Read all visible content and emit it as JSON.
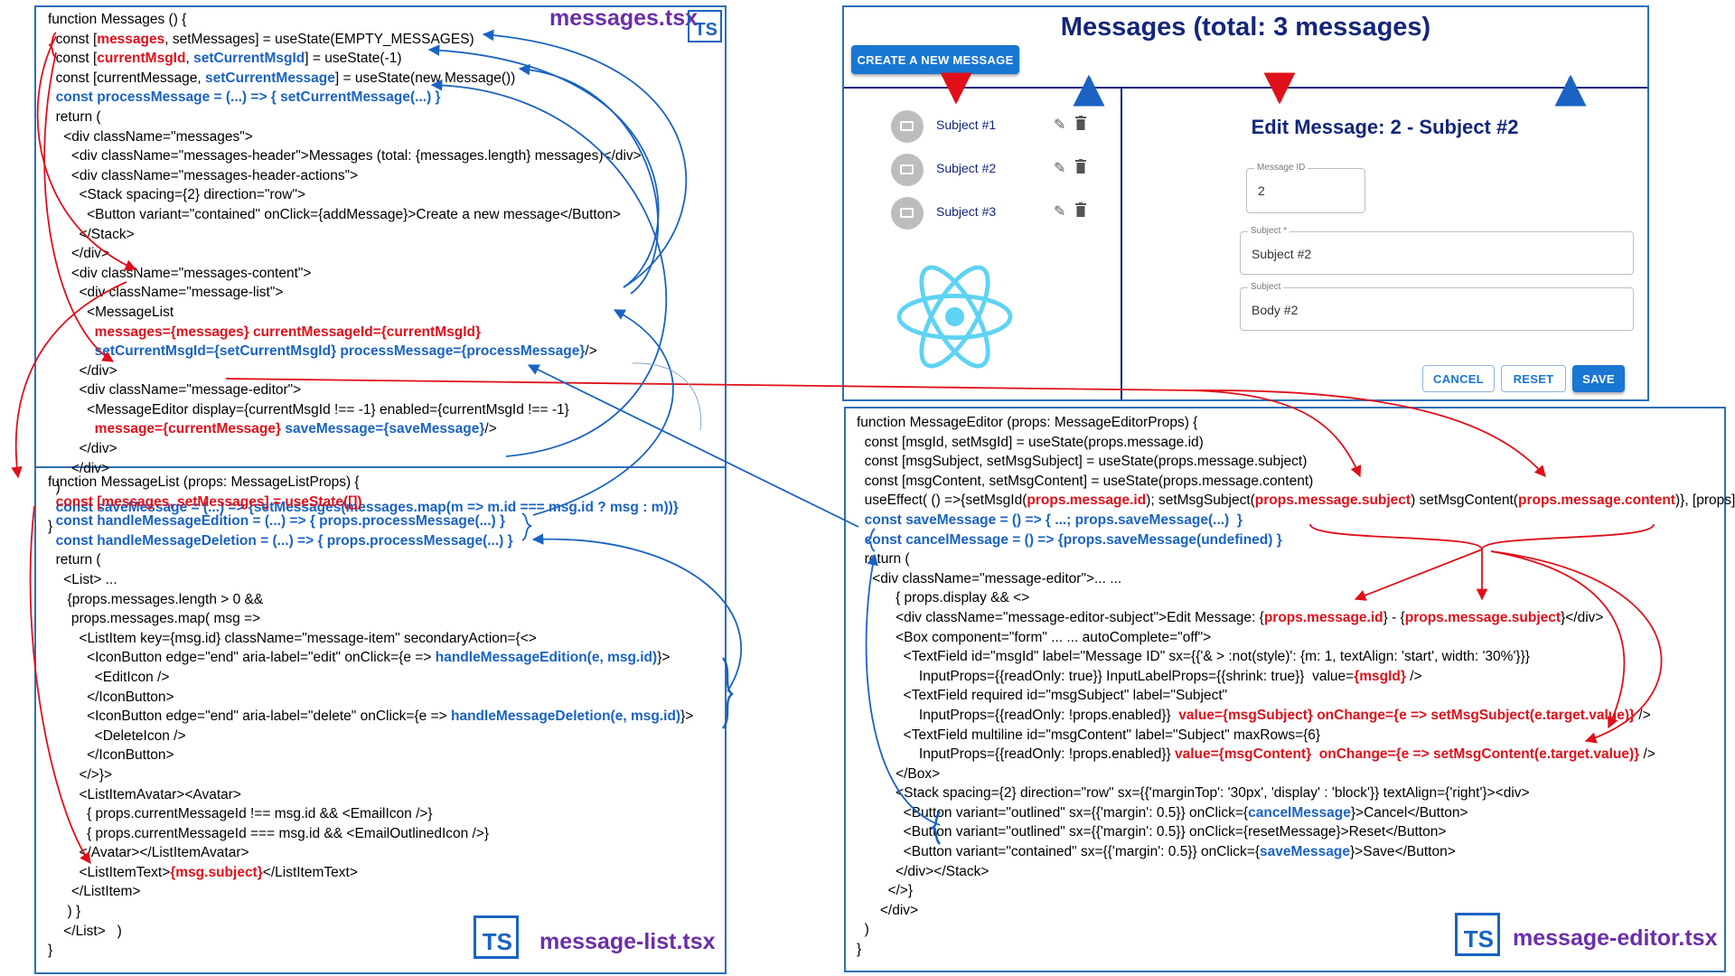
{
  "files": {
    "messages": "messages.tsx",
    "list": "message-list.tsx",
    "editor": "message-editor.tsx",
    "ts_badge": "TS"
  },
  "colors": {
    "red": "#e0101a",
    "blue": "#1a63c2",
    "purple": "#6b2fa8",
    "frame": "#2d6fb8"
  },
  "messages_code": [
    [
      {
        "t": "function Messages () {",
        "c": "k"
      }
    ],
    [
      {
        "t": "  const [",
        "c": "k"
      },
      {
        "t": "messages",
        "c": "r"
      },
      {
        "t": ", setMessages] = useState(EMPTY_MESSAGES)",
        "c": "k"
      }
    ],
    [
      {
        "t": "  const [",
        "c": "k"
      },
      {
        "t": "currentMsgId",
        "c": "r"
      },
      {
        "t": ", ",
        "c": "k"
      },
      {
        "t": "setCurrentMsgId",
        "c": "b"
      },
      {
        "t": "] = useState(-1)",
        "c": "k"
      }
    ],
    [
      {
        "t": "  const [currentMessage, ",
        "c": "k"
      },
      {
        "t": "setCurrentMessage",
        "c": "b"
      },
      {
        "t": "] = useState(new Message())",
        "c": "k"
      }
    ],
    [
      {
        "t": "  const processMessage = (...) => { setCurrentMessage(...) }",
        "c": "b"
      }
    ],
    [
      {
        "t": "  return (",
        "c": "k"
      }
    ],
    [
      {
        "t": "    <div className=\"messages\">",
        "c": "k"
      }
    ],
    [
      {
        "t": "      <div className=\"messages-header\">Messages (total: {messages.length} messages)</div>",
        "c": "k"
      }
    ],
    [
      {
        "t": "      <div className=\"messages-header-actions\">",
        "c": "k"
      }
    ],
    [
      {
        "t": "        <Stack spacing={2} direction=\"row\">",
        "c": "k"
      }
    ],
    [
      {
        "t": "          <Button variant=\"contained\" onClick={addMessage}>Create a new message</Button>",
        "c": "k"
      }
    ],
    [
      {
        "t": "        </Stack>",
        "c": "k"
      }
    ],
    [
      {
        "t": "      </div>",
        "c": "k"
      }
    ],
    [
      {
        "t": "      <div className=\"messages-content\">",
        "c": "k"
      }
    ],
    [
      {
        "t": "        <div className=\"message-list\">",
        "c": "k"
      }
    ],
    [
      {
        "t": "          <MessageList",
        "c": "k"
      }
    ],
    [
      {
        "t": "            messages={messages} currentMessageId={currentMsgId}",
        "c": "r"
      }
    ],
    [
      {
        "t": "            setCurrentMsgId={setCurrentMsgId} processMessage={processMessage}",
        "c": "b"
      },
      {
        "t": "/>",
        "c": "k"
      }
    ],
    [
      {
        "t": "        </div>",
        "c": "k"
      }
    ],
    [
      {
        "t": "        <div className=\"message-editor\">",
        "c": "k"
      }
    ],
    [
      {
        "t": "          <MessageEditor display={currentMsgId !== -1} enabled={currentMsgId !== -1}",
        "c": "k"
      }
    ],
    [
      {
        "t": "            message={currentMessage}",
        "c": "r"
      },
      {
        "t": " saveMessage={saveMessage}",
        "c": "b"
      },
      {
        "t": "/>",
        "c": "k"
      }
    ],
    [
      {
        "t": "        </div>",
        "c": "k"
      }
    ],
    [
      {
        "t": "      </div>",
        "c": "k"
      }
    ],
    [
      {
        "t": "  )",
        "c": "k"
      }
    ],
    [
      {
        "t": "  const saveMessage = (...) => {setMessages(messages.map(m => m.id === msg.id ? msg : m))}",
        "c": "b"
      }
    ],
    [
      {
        "t": "}",
        "c": "k"
      }
    ]
  ],
  "list_code": [
    [
      {
        "t": "function MessageList (props: MessageListProps) {",
        "c": "k"
      }
    ],
    [
      {
        "t": "  const [messages, setMessages] = useState([])",
        "c": "r"
      }
    ],
    [
      {
        "t": "  const handleMessageEdition = (...) => { props.processMessage(...) }",
        "c": "b"
      }
    ],
    [
      {
        "t": "  const handleMessageDeletion = (...) => { props.processMessage(...) }",
        "c": "b"
      }
    ],
    [
      {
        "t": "  return (",
        "c": "k"
      }
    ],
    [
      {
        "t": "    <List> ...",
        "c": "k"
      }
    ],
    [
      {
        "t": "     {props.messages.length > 0 &&",
        "c": "k"
      }
    ],
    [
      {
        "t": "      props.messages.map( msg =>",
        "c": "k"
      }
    ],
    [
      {
        "t": "        <ListItem key={msg.id} className=\"message-item\" secondaryAction={<>",
        "c": "k"
      }
    ],
    [
      {
        "t": "          <IconButton edge=\"end\" aria-label=\"edit\" onClick={e => ",
        "c": "k"
      },
      {
        "t": "handleMessageEdition(e, msg.id)",
        "c": "b"
      },
      {
        "t": "}>",
        "c": "k"
      }
    ],
    [
      {
        "t": "            <EditIcon />",
        "c": "k"
      }
    ],
    [
      {
        "t": "          </IconButton>",
        "c": "k"
      }
    ],
    [
      {
        "t": "          <IconButton edge=\"end\" aria-label=\"delete\" onClick={e => ",
        "c": "k"
      },
      {
        "t": "handleMessageDeletion(e, msg.id)",
        "c": "b"
      },
      {
        "t": "}>",
        "c": "k"
      }
    ],
    [
      {
        "t": "            <DeleteIcon />",
        "c": "k"
      }
    ],
    [
      {
        "t": "          </IconButton>",
        "c": "k"
      }
    ],
    [
      {
        "t": "        </>}>",
        "c": "k"
      }
    ],
    [
      {
        "t": "        <ListItemAvatar><Avatar>",
        "c": "k"
      }
    ],
    [
      {
        "t": "          { props.currentMessageId !== msg.id && <EmailIcon />}",
        "c": "k"
      }
    ],
    [
      {
        "t": "          { props.currentMessageId === msg.id && <EmailOutlinedIcon />}",
        "c": "k"
      }
    ],
    [
      {
        "t": "        </Avatar></ListItemAvatar>",
        "c": "k"
      }
    ],
    [
      {
        "t": "        <ListItemText>",
        "c": "k"
      },
      {
        "t": "{msg.subject}",
        "c": "r"
      },
      {
        "t": "</ListItemText>",
        "c": "k"
      }
    ],
    [
      {
        "t": "      </ListItem>",
        "c": "k"
      }
    ],
    [
      {
        "t": "     ) }",
        "c": "k"
      }
    ],
    [
      {
        "t": "    </List>   )",
        "c": "k"
      }
    ],
    [
      {
        "t": "}",
        "c": "k"
      }
    ]
  ],
  "editor_code": [
    [
      {
        "t": "function MessageEditor (props: MessageEditorProps) {",
        "c": "k"
      }
    ],
    [
      {
        "t": "  const [msgId, setMsgId] = useState(props.message.id)",
        "c": "k"
      }
    ],
    [
      {
        "t": "  const [msgSubject, setMsgSubject] = useState(props.message.subject)",
        "c": "k"
      }
    ],
    [
      {
        "t": "  const [msgContent, setMsgContent] = useState(props.message.content)",
        "c": "k"
      }
    ],
    [
      {
        "t": "  useEffect( () =>{setMsgId(",
        "c": "k"
      },
      {
        "t": "props.message.id",
        "c": "r"
      },
      {
        "t": "); setMsgSubject(",
        "c": "k"
      },
      {
        "t": "props.message.subject",
        "c": "r"
      },
      {
        "t": ") setMsgContent(",
        "c": "k"
      },
      {
        "t": "props.message.content",
        "c": "r"
      },
      {
        "t": ")}, [props])",
        "c": "k"
      }
    ],
    [
      {
        "t": "  const saveMessage = () => { ...; props.saveMessage(...)  }",
        "c": "b"
      }
    ],
    [
      {
        "t": "  const cancelMessage = () => {props.saveMessage(undefined) }",
        "c": "b"
      }
    ],
    [
      {
        "t": "  return (",
        "c": "k"
      }
    ],
    [
      {
        "t": "    <div className=\"message-editor\">... ...",
        "c": "k"
      }
    ],
    [
      {
        "t": "          { props.display && <>",
        "c": "k"
      }
    ],
    [
      {
        "t": "          <div className=\"message-editor-subject\">Edit Message: {",
        "c": "k"
      },
      {
        "t": "props.message.id",
        "c": "r"
      },
      {
        "t": "} - {",
        "c": "k"
      },
      {
        "t": "props.message.subject",
        "c": "r"
      },
      {
        "t": "}</div>",
        "c": "k"
      }
    ],
    [
      {
        "t": "          <Box component=\"form\" ... ... autoComplete=\"off\">",
        "c": "k"
      }
    ],
    [
      {
        "t": "            <TextField id=\"msgId\" label=\"Message ID\" sx={{'& > :not(style)': {m: 1, textAlign: 'start', width: '30%'}}}",
        "c": "k"
      }
    ],
    [
      {
        "t": "                InputProps={{readOnly: true}} InputLabelProps={{shrink: true}}  value=",
        "c": "k"
      },
      {
        "t": "{msgId}",
        "c": "r"
      },
      {
        "t": " />",
        "c": "k"
      }
    ],
    [
      {
        "t": "            <TextField required id=\"msgSubject\" label=\"Subject\"",
        "c": "k"
      }
    ],
    [
      {
        "t": "                InputProps={{readOnly: !props.enabled}}  ",
        "c": "k"
      },
      {
        "t": "value={msgSubject} onChange={e => setMsgSubject(e.target.value)}",
        "c": "r"
      },
      {
        "t": " />",
        "c": "k"
      }
    ],
    [
      {
        "t": "            <TextField multiline id=\"msgContent\" label=\"Subject\" maxRows={6}",
        "c": "k"
      }
    ],
    [
      {
        "t": "                InputProps={{readOnly: !props.enabled}} ",
        "c": "k"
      },
      {
        "t": "value={msgContent}  onChange={e => setMsgContent(e.target.value)}",
        "c": "r"
      },
      {
        "t": " />",
        "c": "k"
      }
    ],
    [
      {
        "t": "          </Box>",
        "c": "k"
      }
    ],
    [
      {
        "t": "          <Stack spacing={2} direction=\"row\" sx={{'marginTop': '30px', 'display' : 'block'}} textAlign={'right'}><div>",
        "c": "k"
      }
    ],
    [
      {
        "t": "            <Button variant=\"outlined\" sx={{'margin': 0.5}} onClick={",
        "c": "k"
      },
      {
        "t": "cancelMessage",
        "c": "b"
      },
      {
        "t": "}>Cancel</Button>",
        "c": "k"
      }
    ],
    [
      {
        "t": "            <Button variant=\"outlined\" sx={{'margin': 0.5}} onClick={resetMessage}>Reset</Button>",
        "c": "k"
      }
    ],
    [
      {
        "t": "            <Button variant=\"contained\" sx={{'margin': 0.5}} onClick={",
        "c": "k"
      },
      {
        "t": "saveMessage",
        "c": "b"
      },
      {
        "t": "}>Save</Button>",
        "c": "k"
      }
    ],
    [
      {
        "t": "          </div></Stack>",
        "c": "k"
      }
    ],
    [
      {
        "t": "        </>}",
        "c": "k"
      }
    ],
    [
      {
        "t": "      </div>",
        "c": "k"
      }
    ],
    [
      {
        "t": "  )",
        "c": "k"
      }
    ],
    [
      {
        "t": "}",
        "c": "k"
      }
    ]
  ],
  "ui": {
    "title": "Messages (total: 3 messages)",
    "create_button": "Create a new message",
    "messages": [
      {
        "subject": "Subject #1"
      },
      {
        "subject": "Subject #2"
      },
      {
        "subject": "Subject #3"
      }
    ],
    "editor_title": "Edit Message: 2 - Subject #2",
    "fields": {
      "id_label": "Message ID",
      "id_value": "2",
      "subject_label": "Subject *",
      "subject_value": "Subject #2",
      "content_label": "Subject",
      "content_value": "Body #2"
    },
    "buttons": {
      "cancel": "Cancel",
      "reset": "Reset",
      "save": "Save"
    }
  }
}
